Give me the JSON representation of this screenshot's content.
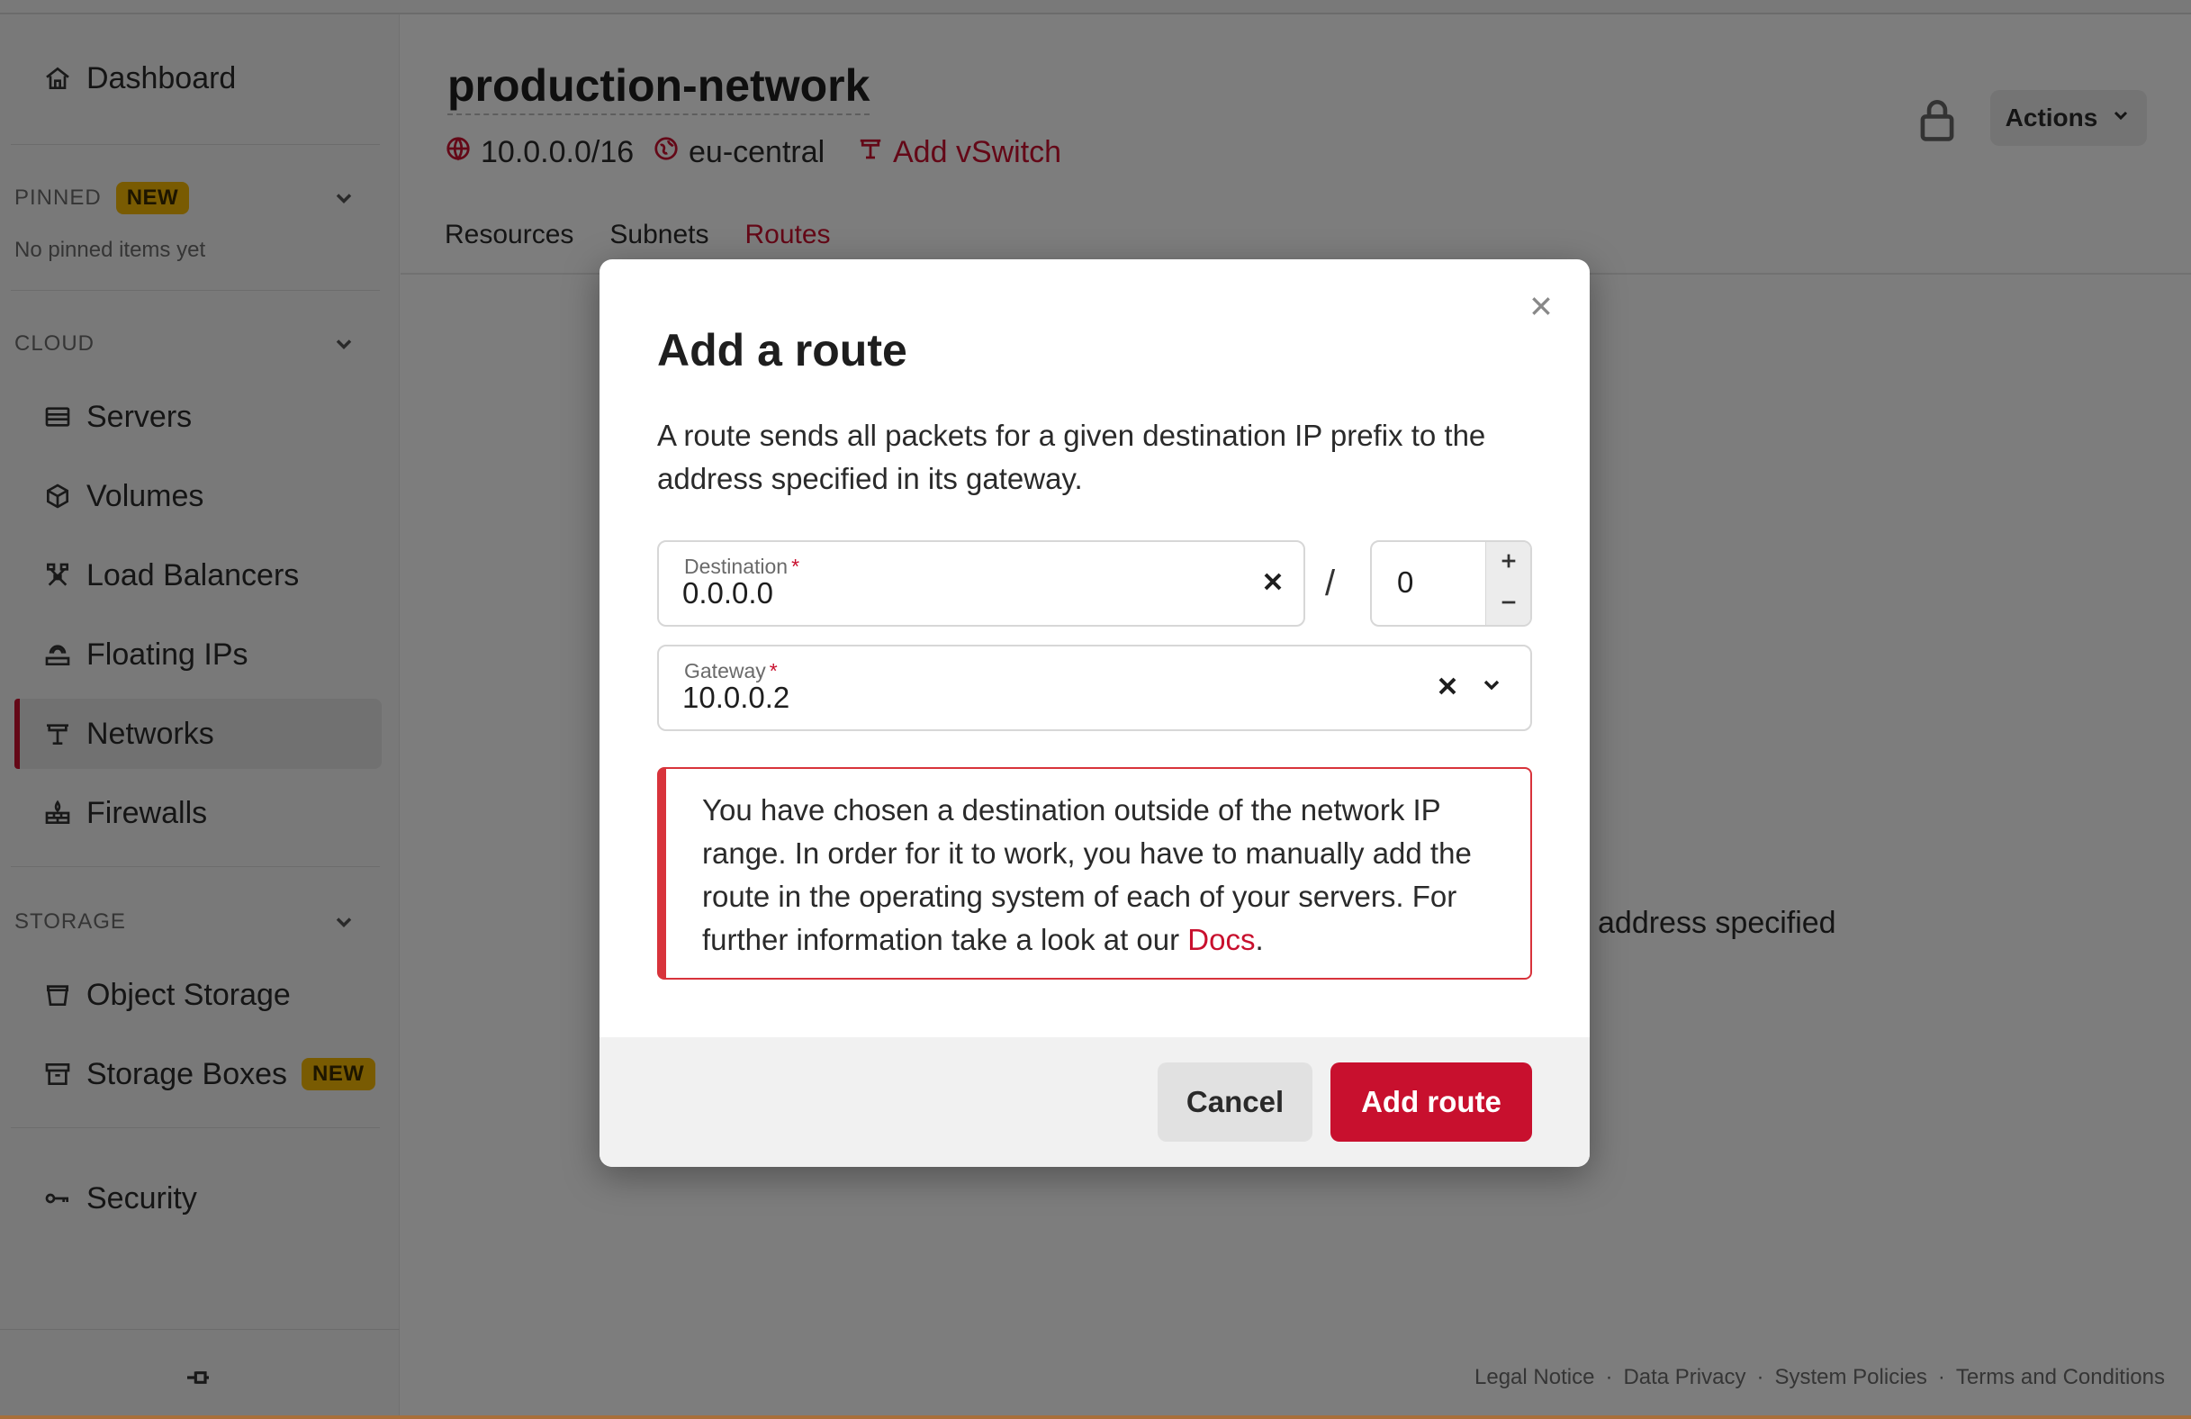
{
  "sidebar": {
    "dashboard": "Dashboard",
    "pinned_heading": "PINNED",
    "pinned_badge": "NEW",
    "pinned_empty": "No pinned items yet",
    "cloud_heading": "CLOUD",
    "cloud_items": [
      "Servers",
      "Volumes",
      "Load Balancers",
      "Floating IPs",
      "Networks",
      "Firewalls"
    ],
    "active_item": "Networks",
    "storage_heading": "STORAGE",
    "storage_items": [
      "Object Storage",
      "Storage Boxes"
    ],
    "storage_boxes_badge": "NEW",
    "security": "Security"
  },
  "header": {
    "title": "production-network",
    "ip_range": "10.0.0.0/16",
    "zone": "eu-central",
    "add_vswitch": "Add vSwitch",
    "actions_label": "Actions"
  },
  "tabs": [
    "Resources",
    "Subnets",
    "Routes"
  ],
  "active_tab": "Routes",
  "background_text": "address specified",
  "footer": [
    "Legal Notice",
    "Data Privacy",
    "System Policies",
    "Terms and Conditions"
  ],
  "footer_separator": "·",
  "modal": {
    "title": "Add a route",
    "description": "A route sends all packets for a given destination IP prefix to the address specified in its gateway.",
    "destination_label": "Destination",
    "destination_value": "0.0.0.0",
    "required_mark": "*",
    "slash": "/",
    "prefix_value": "0",
    "gateway_label": "Gateway",
    "gateway_value": "10.0.0.2",
    "alert_text": "You have chosen a destination outside of the network IP range. In order for it to work, you have to manually add the route in the operating system of each of your servers. For further information take a look at our",
    "alert_link": "Docs",
    "alert_end": ".",
    "cancel_label": "Cancel",
    "submit_label": "Add route"
  },
  "colors": {
    "accent": "#c8102e",
    "badge": "#f2b705",
    "alert_border": "#d8333b"
  },
  "icons": [
    "home-icon",
    "chevron-down-icon",
    "server-icon",
    "volume-icon",
    "load-balancer-icon",
    "floating-ip-icon",
    "network-icon",
    "firewall-icon",
    "bucket-icon",
    "archive-icon",
    "key-icon",
    "pin-icon",
    "globe-icon",
    "location-icon",
    "vswitch-icon",
    "lock-icon",
    "close-icon",
    "plus-icon",
    "minus-icon"
  ]
}
